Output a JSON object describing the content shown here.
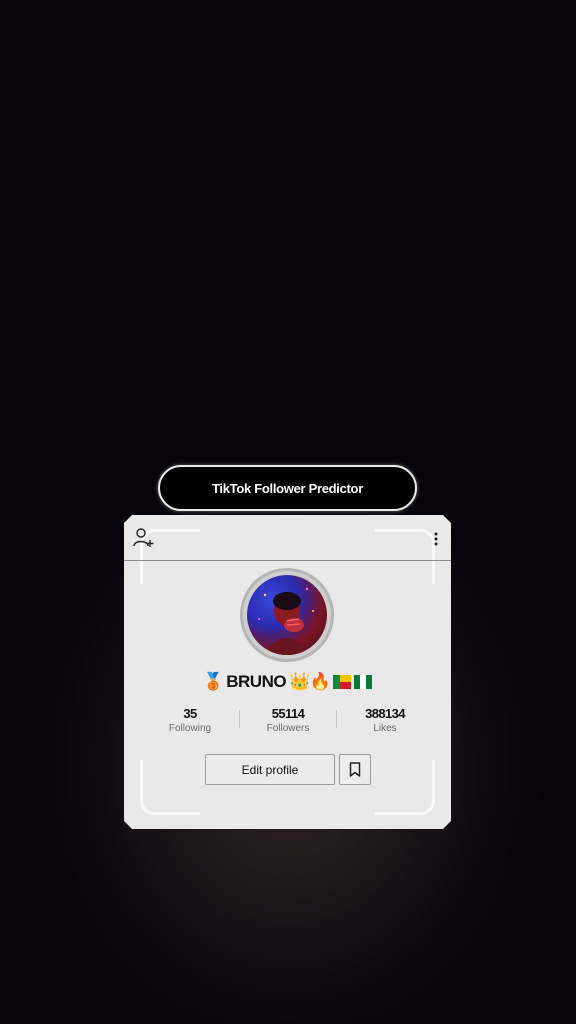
{
  "header": {
    "title": "TikTok Follower Predictor"
  },
  "profile": {
    "username": "BRUNO",
    "username_emojis_before": "🥉",
    "username_emojis_after": "👑🔥",
    "flags": [
      "flag-benin",
      "flag-nigeria"
    ],
    "avatar_icon": "profile-photo"
  },
  "stats": [
    {
      "value": "35",
      "label": "Following"
    },
    {
      "value": "55114",
      "label": "Followers"
    },
    {
      "value": "388134",
      "label": "Likes"
    }
  ],
  "actions": {
    "edit_label": "Edit profile",
    "bookmark_icon": "bookmark-icon",
    "add_user_icon": "add-user-icon",
    "more_icon": "more-vertical-icon"
  },
  "colors": {
    "card_bg": "#e9e9e9",
    "pill_bg": "#000000",
    "page_bg": "#06040a"
  }
}
